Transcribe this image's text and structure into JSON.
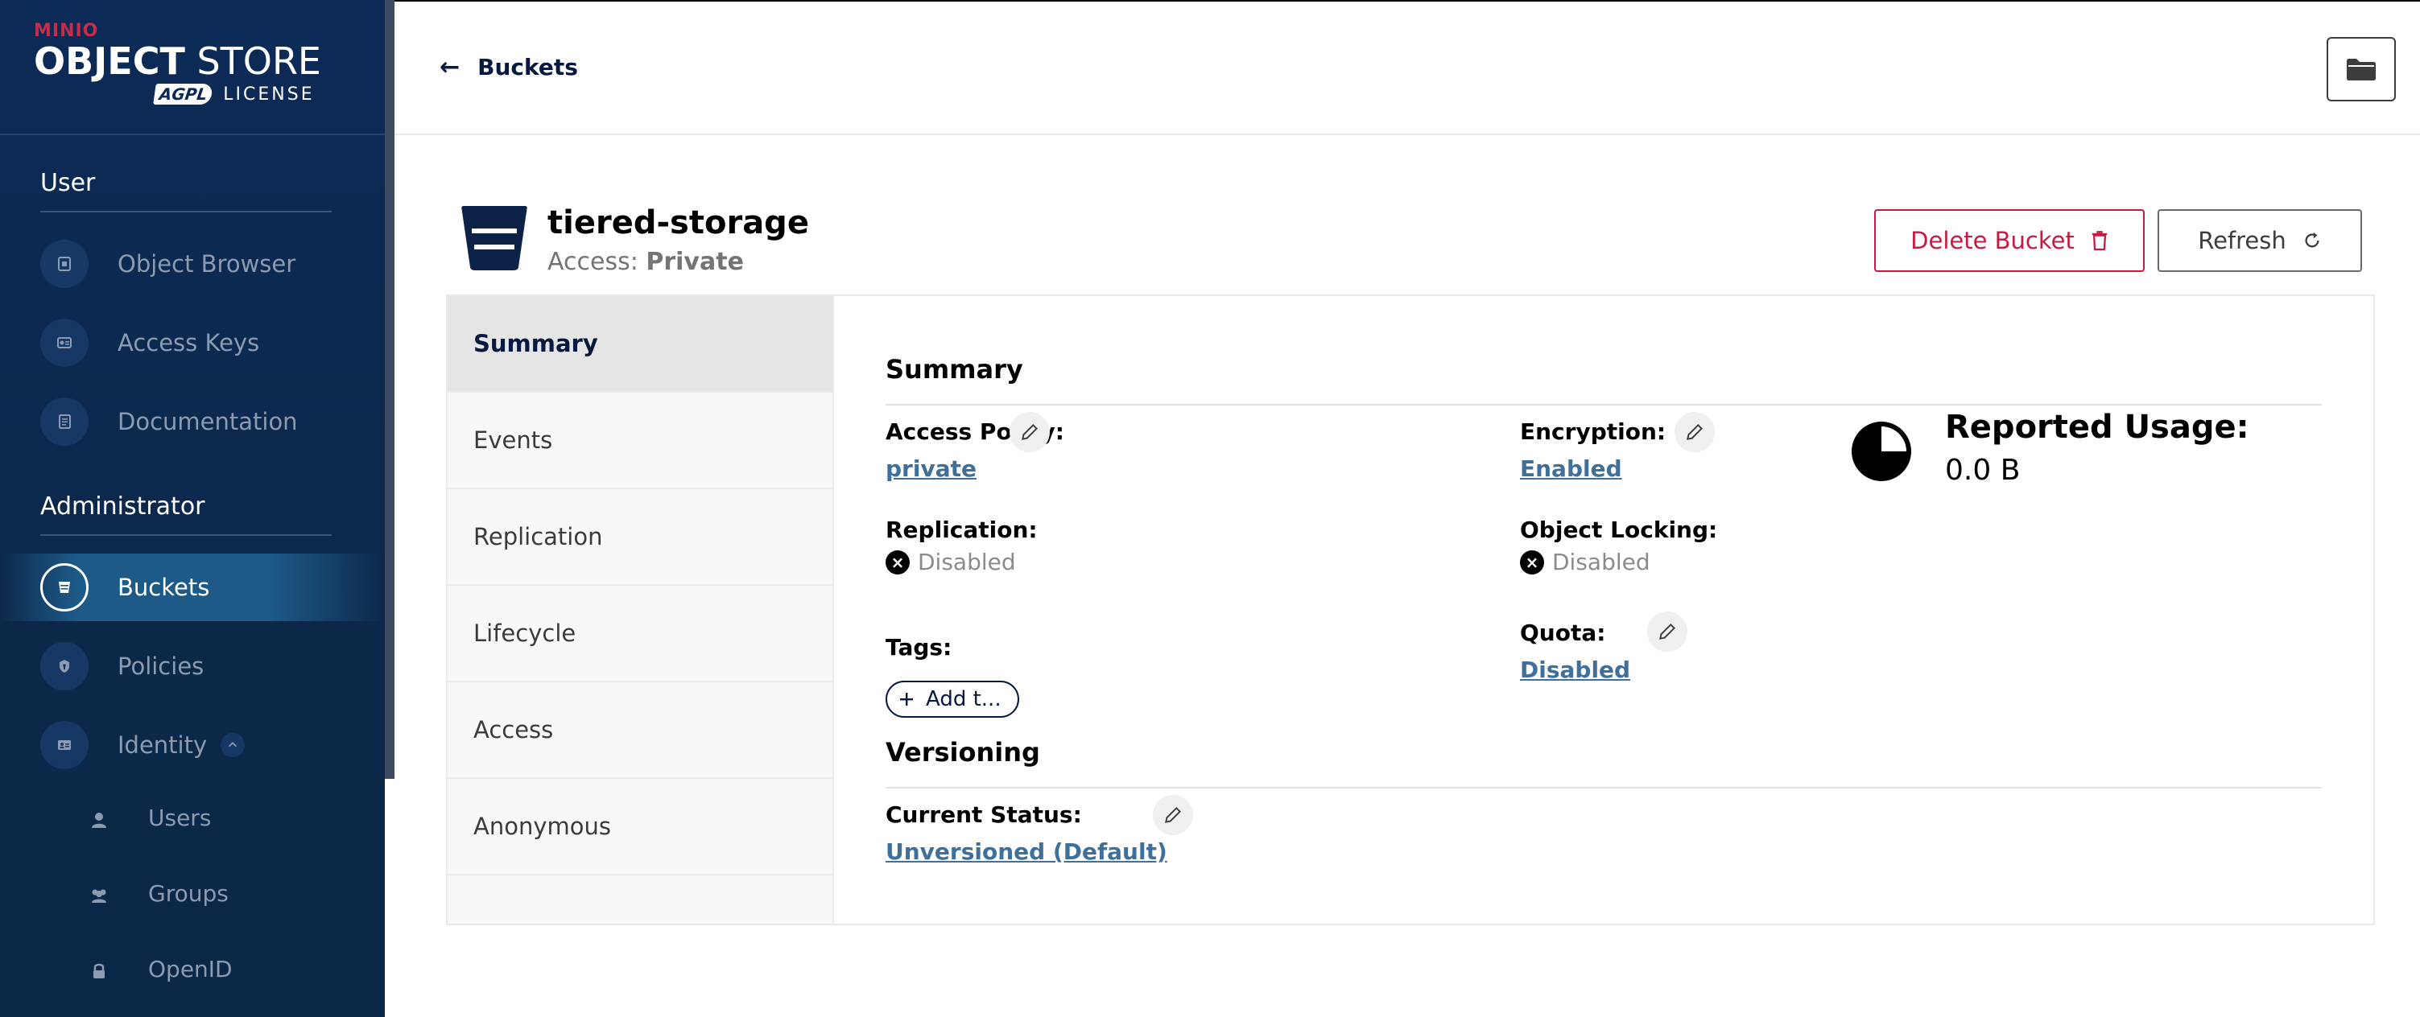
{
  "sidebar": {
    "logo": {
      "brand": "MINIO",
      "product_bold": "OBJECT",
      "product_light": " STORE",
      "badge": "AGPL",
      "license": "LICENSE"
    },
    "sections": {
      "user": "User",
      "admin": "Administrator"
    },
    "user_items": [
      {
        "label": "Object Browser",
        "icon": "object-browser-icon"
      },
      {
        "label": "Access Keys",
        "icon": "access-keys-icon"
      },
      {
        "label": "Documentation",
        "icon": "documentation-icon"
      }
    ],
    "admin_items": [
      {
        "label": "Buckets",
        "icon": "bucket-icon",
        "active": true
      },
      {
        "label": "Policies",
        "icon": "shield-icon"
      },
      {
        "label": "Identity",
        "icon": "identity-icon",
        "expanded": true
      }
    ],
    "identity_subitems": [
      {
        "label": "Users",
        "icon": "user-icon"
      },
      {
        "label": "Groups",
        "icon": "groups-icon"
      },
      {
        "label": "OpenID",
        "icon": "lock-icon"
      }
    ]
  },
  "header": {
    "back_label": "Buckets"
  },
  "bucket": {
    "name": "tiered-storage",
    "access_prefix": "Access:",
    "access_value": "Private"
  },
  "actions": {
    "delete_label": "Delete Bucket",
    "refresh_label": "Refresh"
  },
  "tabs": [
    {
      "label": "Summary",
      "active": true
    },
    {
      "label": "Events"
    },
    {
      "label": "Replication"
    },
    {
      "label": "Lifecycle"
    },
    {
      "label": "Access"
    },
    {
      "label": "Anonymous"
    }
  ],
  "summary": {
    "title": "Summary",
    "access_policy_label": "Access Policy:",
    "access_policy_value": "private",
    "encryption_label": "Encryption:",
    "encryption_value": "Enabled",
    "replication_label": "Replication:",
    "replication_value": "Disabled",
    "object_locking_label": "Object Locking:",
    "object_locking_value": "Disabled",
    "tags_label": "Tags:",
    "add_tag_label": "Add t...",
    "quota_label": "Quota:",
    "quota_value": "Disabled",
    "usage_title": "Reported Usage:",
    "usage_value": "0.0 B"
  },
  "versioning": {
    "title": "Versioning",
    "status_label": "Current Status:",
    "status_value": "Unversioned (Default)"
  },
  "colors": {
    "sidebar_bg": "#0c2a57",
    "accent_danger": "#c51b3f",
    "link": "#3f6f9b",
    "active_nav": "#1d5a88"
  }
}
